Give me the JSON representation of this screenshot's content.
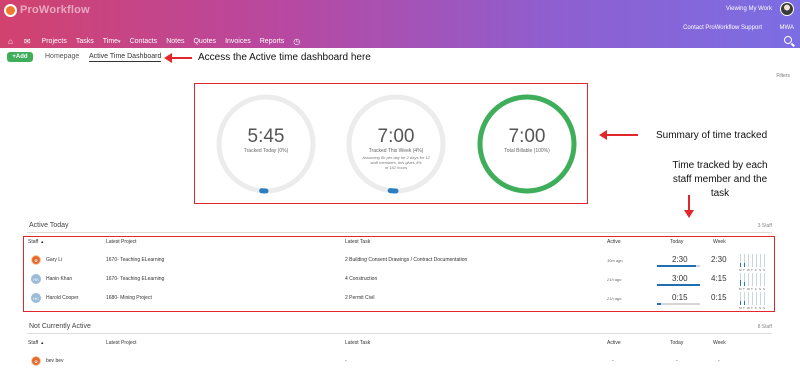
{
  "header": {
    "logo_text": "ProWorkflow",
    "viewing": "Viewing My Work",
    "support": "Contact ProWorkflow Support",
    "user_initials": "MWA",
    "nav": [
      "Projects",
      "Tasks",
      "Time",
      "Contacts",
      "Notes",
      "Quotes",
      "Invoices",
      "Reports"
    ],
    "time_caret": "▾",
    "icons": [
      "home-icon",
      "mail-icon",
      "clock-icon",
      "search-icon"
    ]
  },
  "toolbar": {
    "add_label": "+Add",
    "breadcrumb_home": "Homepage",
    "breadcrumb_active": "Active Time Dashboard",
    "filters": "Filters"
  },
  "annotations": {
    "access": "Access the Active time dashboard here",
    "summary": "Summary of time tracked",
    "staff_line1": "Time tracked by each",
    "staff_line2": "staff member and the",
    "staff_line3": "task",
    "color": "#e3262c"
  },
  "summary": {
    "today": {
      "value": "5:45",
      "label": "Tracked Today (0%)",
      "progress": 0.03
    },
    "week": {
      "value": "7:00",
      "label": "Tracked This Week (4%)",
      "note1": "Assuming 8h per day for 2 days for 12",
      "note2": "staff members, this gives 4%",
      "note3": "of 162 hours",
      "progress": 0.04
    },
    "billable": {
      "value": "7:00",
      "label": "Total Billable (100%)",
      "progress": 1.0,
      "color": "#3fae5a"
    }
  },
  "active_today": {
    "title": "Active Today",
    "count": "3 Staff",
    "columns": {
      "staff": "Staff",
      "project": "Latest Project",
      "task": "Latest Task",
      "active": "Active",
      "today": "Today",
      "week": "Week"
    },
    "rows": [
      {
        "initials": "",
        "name": "Gary Li",
        "project": "1670- Teaching ELearning",
        "task": "2 Building Consent Drawings / Contract Documentation",
        "active": "10m ago",
        "today": "2:30",
        "week": "2:30",
        "today_fill": 0.9
      },
      {
        "initials": "HK",
        "name": "Hanin Khan",
        "project": "1670- Teaching ELearning",
        "task": "4 Construction",
        "active": "21h ago",
        "today": "3:00",
        "week": "4:15",
        "today_fill": 1.0
      },
      {
        "initials": "HC",
        "name": "Harold Cooper",
        "project": "1680- Mining Project",
        "task": "2 Permit Civil",
        "active": "21h ago",
        "today": "0:15",
        "week": "0:15",
        "today_fill": 0.1
      }
    ],
    "mini_days": [
      "M",
      "T",
      "W",
      "T",
      "F",
      "S",
      "S"
    ]
  },
  "not_active": {
    "title": "Not Currently Active",
    "count": "8 Staff",
    "columns": {
      "staff": "Staff",
      "project": "Latest Project",
      "task": "Latest Task",
      "active": "Active",
      "today": "Today",
      "week": "Week"
    },
    "rows": [
      {
        "initials": "",
        "name": "bev bev",
        "project": "-",
        "task": "-",
        "active": "-",
        "today": "-",
        "week": "-"
      }
    ]
  }
}
